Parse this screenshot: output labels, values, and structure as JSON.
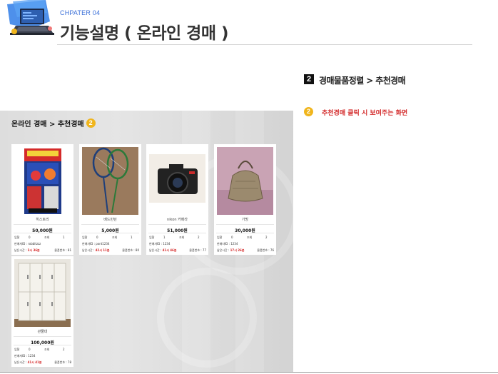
{
  "header": {
    "chapter": "CHPATER 04",
    "title": "기능설명 ( 온라인 경매 )"
  },
  "step": {
    "number": "2",
    "title": "경매물품정렬 > 추천경매"
  },
  "note": {
    "badge": "2",
    "text": "추천경매 클릭 시 보여주는 화면"
  },
  "panel": {
    "breadcrumb": "온라인 경매 > 추천경매",
    "badge": "2"
  },
  "labels": {
    "bid": "입찰",
    "views": "조회",
    "seller_prefix": "판매자ID : ",
    "remaining_prefix": "남은시간 : ",
    "item_no_prefix": "물품번호 : "
  },
  "products": [
    {
      "name": "히스토리",
      "price": "50,000원",
      "bids": "0",
      "views": "1",
      "seller": "robbitzzz",
      "remaining": "2시 36분",
      "item_no": "81"
    },
    {
      "name": "배드민턴",
      "price": "5,000원",
      "bids": "0",
      "views": "1",
      "seller": "pont1234",
      "remaining": "42시 11분",
      "item_no": "80"
    },
    {
      "name": "nikon 카메라",
      "price": "51,000원",
      "bids": "1",
      "views": "2",
      "seller": "1234",
      "remaining": "41시 46분",
      "item_no": "77"
    },
    {
      "name": "가방",
      "price": "30,000원",
      "bids": "0",
      "views": "2",
      "seller": "1234",
      "remaining": "17시 26분",
      "item_no": "76"
    },
    {
      "name": "관물대",
      "price": "100,000원",
      "bids": "0",
      "views": "2",
      "seller": "1234",
      "remaining": "41시 41분",
      "item_no": "78"
    }
  ],
  "colors": {
    "accent_red": "#d32b2b",
    "badge_yellow": "#f0b51c",
    "chapter_blue": "#3a6fd8"
  }
}
